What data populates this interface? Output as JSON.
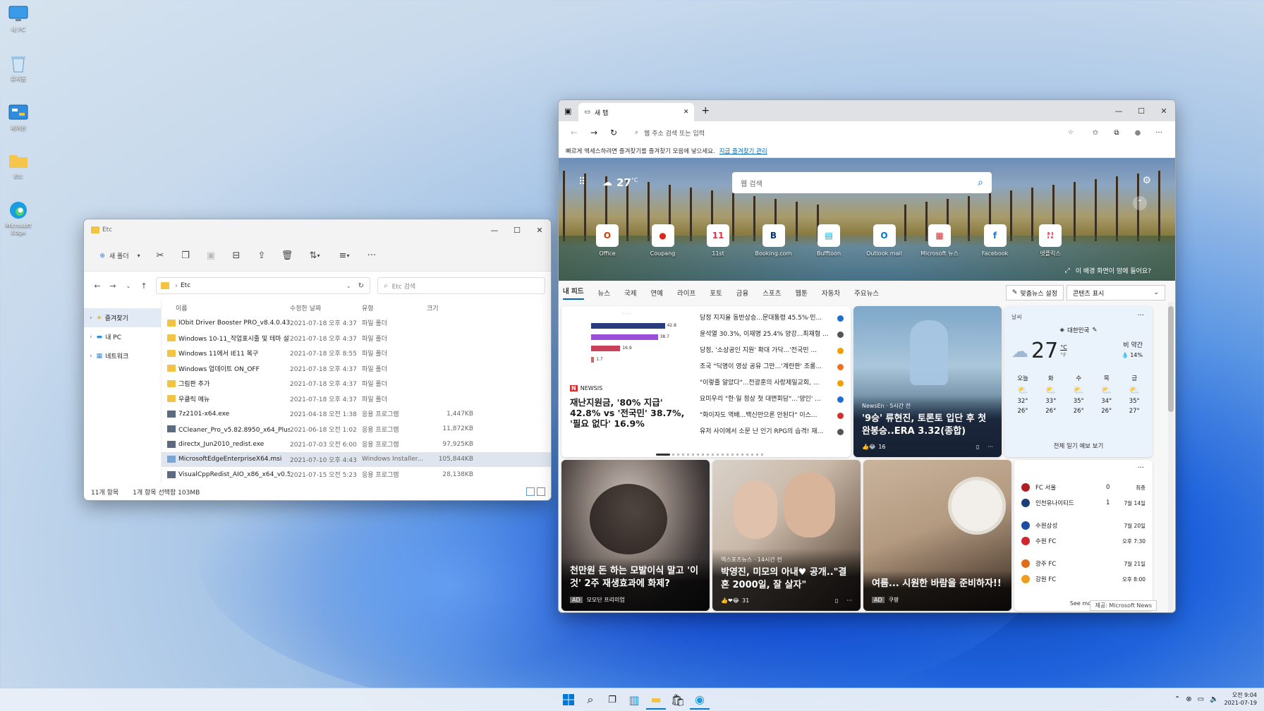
{
  "desktop": {
    "icons": [
      {
        "label": "내 PC",
        "icon": "monitor-icon"
      },
      {
        "label": "휴지통",
        "icon": "recycle-bin-icon"
      },
      {
        "label": "제어판",
        "icon": "control-panel-icon"
      },
      {
        "label": "Etc",
        "icon": "folder-icon"
      },
      {
        "label": "Microsoft Edge",
        "icon": "edge-icon"
      }
    ]
  },
  "explorer": {
    "title": "Etc",
    "toolbar": {
      "new_folder": "새 폴더",
      "more": "···"
    },
    "address": "Etc",
    "search_placeholder": "Etc 검색",
    "sidebar": [
      {
        "label": "즐겨찾기"
      },
      {
        "label": "내 PC"
      },
      {
        "label": "네트워크"
      }
    ],
    "columns": {
      "name": "이름",
      "date": "수정한 날짜",
      "type": "유형",
      "size": "크기"
    },
    "files": [
      {
        "name": "IObit Driver Booster PRO_v8.4.0.432",
        "date": "2021-07-18 오후 4:37",
        "type": "파일 폴더",
        "size": "",
        "kind": "folder"
      },
      {
        "name": "Windows 10-11_작업표시줄 및 테마 설정",
        "date": "2021-07-18 오후 4:37",
        "type": "파일 폴더",
        "size": "",
        "kind": "folder"
      },
      {
        "name": "Windows 11에서 IE11 복구",
        "date": "2021-07-18 오후 8:55",
        "type": "파일 폴더",
        "size": "",
        "kind": "folder"
      },
      {
        "name": "Windows 업데이트 ON_OFF",
        "date": "2021-07-18 오후 4:37",
        "type": "파일 폴더",
        "size": "",
        "kind": "folder"
      },
      {
        "name": "그림판 추가",
        "date": "2021-07-18 오후 4:37",
        "type": "파일 폴더",
        "size": "",
        "kind": "folder"
      },
      {
        "name": "우클릭 메뉴",
        "date": "2021-07-18 오후 4:37",
        "type": "파일 폴더",
        "size": "",
        "kind": "folder"
      },
      {
        "name": "7z2101-x64.exe",
        "date": "2021-04-18 오전 1:38",
        "type": "응용 프로그램",
        "size": "1,447KB",
        "kind": "exe"
      },
      {
        "name": "CCleaner_Pro_v5.82.8950_x64_Plus_단...",
        "date": "2021-06-18 오전 1:02",
        "type": "응용 프로그램",
        "size": "11,872KB",
        "kind": "exe"
      },
      {
        "name": "directx_Jun2010_redist.exe",
        "date": "2021-07-03 오전 6:00",
        "type": "응용 프로그램",
        "size": "97,925KB",
        "kind": "exe"
      },
      {
        "name": "MicrosoftEdgeEnterpriseX64.msi",
        "date": "2021-07-10 오후 4:43",
        "type": "Windows Installer...",
        "size": "105,844KB",
        "kind": "msi",
        "selected": true
      },
      {
        "name": "VisualCppRedist_AIO_x86_x64_v0.51.0_...",
        "date": "2021-07-15 오전 5:23",
        "type": "응용 프로그램",
        "size": "28,138KB",
        "kind": "exe"
      }
    ],
    "status": {
      "count": "11개 항목",
      "selected": "1개 항목 선택함 103MB"
    }
  },
  "edge": {
    "tab_title": "새 탭",
    "url_placeholder": "웹 주소 검색 또는 입력",
    "fav_bar": {
      "text": "빠르게 액세스하려면 즐겨찾기를 즐겨찾기 모음에 넣으세요.",
      "link": "지금 즐겨찾기 관리"
    },
    "weather_small": "27",
    "weather_unit": "°C",
    "search_placeholder": "웹 검색",
    "quick_links": [
      {
        "label": "Office",
        "glyph": "O",
        "color": "#d83b01"
      },
      {
        "label": "Coupang",
        "glyph": "●",
        "color": "#e2231a"
      },
      {
        "label": "11st",
        "glyph": "11",
        "color": "#ff2a3b"
      },
      {
        "label": "Booking.com",
        "glyph": "B",
        "color": "#003580"
      },
      {
        "label": "Bufftoon",
        "glyph": "▤",
        "color": "#00a8e0"
      },
      {
        "label": "Outlook mail",
        "glyph": "O",
        "color": "#0078d4"
      },
      {
        "label": "Microsoft 뉴스",
        "glyph": "▦",
        "color": "#d32f2f"
      },
      {
        "label": "Facebook",
        "glyph": "f",
        "color": "#1877f2"
      },
      {
        "label": "넷플릭스",
        "glyph": "N",
        "color": "#e50914"
      }
    ],
    "bg_question": "이 배경 화면이 맘에 들어요?",
    "news_tabs": [
      "내 피드",
      "뉴스",
      "국제",
      "연예",
      "라이프",
      "포토",
      "금융",
      "스포츠",
      "웹툰",
      "자동차",
      "주요뉴스"
    ],
    "personalize": "맞춤뉴스 설정",
    "content_display": "콘텐츠 표시",
    "card1": {
      "source": "NEWSIS",
      "headline": "재난지원금, '80% 지급' 42.8% vs '전국민' 38.7%, '필요 없다' 16.9%",
      "bars": [
        42.8,
        38.7,
        16.9,
        1.7
      ]
    },
    "headlines": [
      "당정 지지율 동반상승...문대통령 45.5%·민...",
      "윤석열 30.3%, 이재명 25.4% 양강...최재형 ...",
      "당정, '소상공인 지원' 확대 가닥...'전국민 ...",
      "조국 \"딕명이 영상 공유 그만...'계란판' 조롱...",
      "\"이렇줄 알았다\"...전광훈의 사랑제일교회, ...",
      "요미우리 \"한·일 정상 첫 대면회담\"...'양인' ...",
      "\"화이자도 역배...백신만으론 안된다\" 이스...",
      "유저 사이에서 소문 난 인기 RPG의 습격! 재..."
    ],
    "headline_colors": [
      "#1f6fd1",
      "#555555",
      "#f0a000",
      "#f07020",
      "#f0a000",
      "#1f6fd1",
      "#d32f2f",
      "#555555"
    ],
    "card_baseball": {
      "source": "NewsEn · 5시간 전",
      "headline": "'9승' 류현진, 토론토 입단 후 첫 완봉승..ERA 3.32(종합)",
      "reactions": "16"
    },
    "weather_card": {
      "label": "날씨",
      "location": "대한민국",
      "temp": "27",
      "unit": "°C",
      "unit_f": "°F",
      "condition": "비 약간",
      "rain": "14%",
      "days": [
        {
          "d": "오늘",
          "hi": "32°",
          "lo": "26°"
        },
        {
          "d": "화",
          "hi": "33°",
          "lo": "26°"
        },
        {
          "d": "수",
          "hi": "35°",
          "lo": "26°"
        },
        {
          "d": "목",
          "hi": "34°",
          "lo": "26°"
        },
        {
          "d": "금",
          "hi": "35°",
          "lo": "27°"
        }
      ],
      "forecast_link": "전체 일기 예보 보기"
    },
    "card_hair": {
      "headline": "천만원 돈 하는 모발이식 말고 '이것' 2주 재생효과에 화제?",
      "ad": "AD",
      "sponsor": "모모단 프리미엄"
    },
    "card_couple": {
      "source": "엑스포츠뉴스 · 14시간 전",
      "headline": "박영진, 미모의 아내♥ 공개..\"결혼 2000일, 잘 살자\"",
      "reactions": "31"
    },
    "card_fan": {
      "headline": "여름... 시원한 바람을 준비하자!!",
      "ad": "AD",
      "sponsor": "쿠팡"
    },
    "sports": [
      {
        "team": "FC 서울",
        "score": "0",
        "info": "최종"
      },
      {
        "team": "인천유나이티드",
        "score": "1",
        "info": "7월 14일"
      },
      {
        "team": "수원삼성",
        "score": "",
        "info": "7월 20일"
      },
      {
        "team": "수원 FC",
        "score": "",
        "info": "오후 7:30"
      },
      {
        "team": "광주 FC",
        "score": "",
        "info": "7월 21일"
      },
      {
        "team": "강원 FC",
        "score": "",
        "info": "오후 8:00"
      }
    ],
    "see_more": "See more",
    "provider": "제공: Microsoft News"
  },
  "taskbar": {
    "time": "오전 9:04",
    "date": "2021-07-19"
  }
}
